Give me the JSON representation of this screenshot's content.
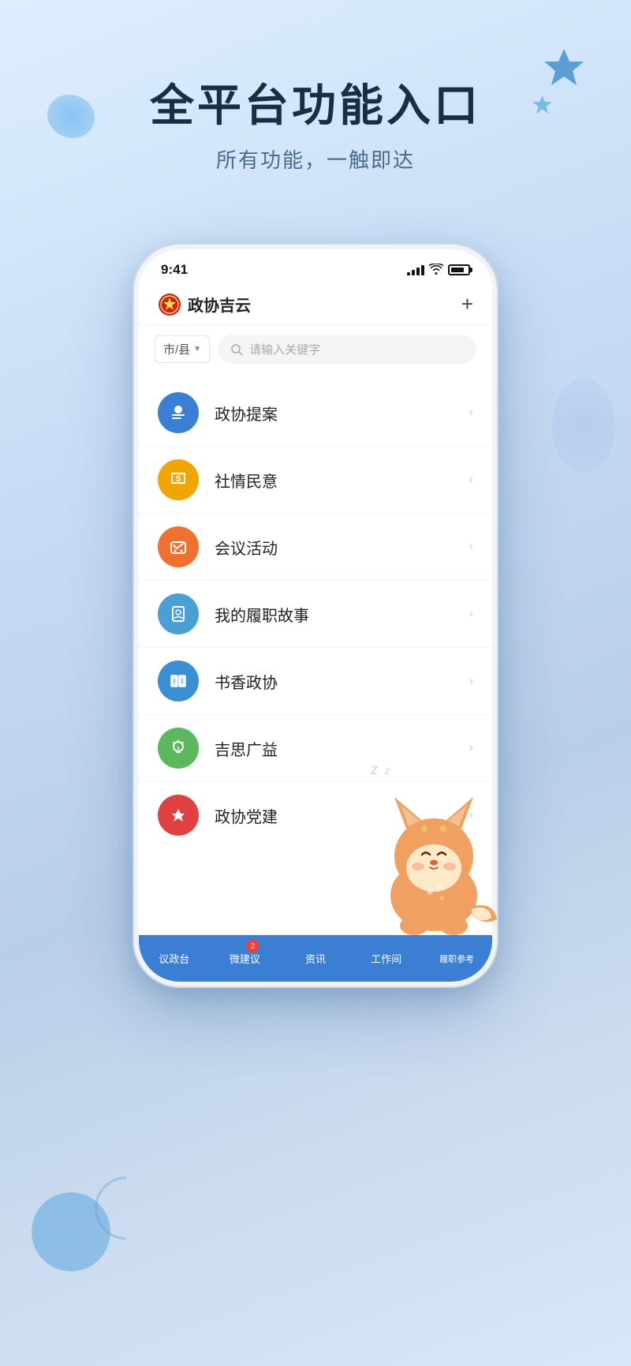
{
  "background": {
    "gradient_start": "#ddeeff",
    "gradient_end": "#d8e8f8"
  },
  "header": {
    "main_title": "全平台功能入口",
    "sub_title": "所有功能，一触即达"
  },
  "phone": {
    "status_bar": {
      "time": "9:41"
    },
    "app_header": {
      "app_name": "政协吉云",
      "add_btn_label": "+"
    },
    "search": {
      "city_label": "市/县",
      "placeholder": "请输入关键字"
    },
    "menu_items": [
      {
        "id": "proposal",
        "label": "政协提案",
        "color": "#3b7fd4",
        "icon": "proposal"
      },
      {
        "id": "social",
        "label": "社情民意",
        "color": "#f0a500",
        "icon": "social"
      },
      {
        "id": "meeting",
        "label": "会议活动",
        "color": "#f07030",
        "icon": "meeting"
      },
      {
        "id": "duty",
        "label": "我的履职故事",
        "color": "#4a9fd4",
        "icon": "duty"
      },
      {
        "id": "book",
        "label": "书香政协",
        "color": "#3a8fd4",
        "icon": "book"
      },
      {
        "id": "idea",
        "label": "吉思广益",
        "color": "#5cb85c",
        "icon": "idea"
      },
      {
        "id": "party",
        "label": "政协党建",
        "color": "#e04040",
        "icon": "party"
      }
    ],
    "tab_bar": [
      {
        "id": "yizheng",
        "label": "议政台",
        "active": true
      },
      {
        "id": "weijianyi",
        "label": "微建议",
        "active": true,
        "badge": "2"
      },
      {
        "id": "zixun",
        "label": "资讯",
        "active": true
      },
      {
        "id": "gongjian",
        "label": "工作间",
        "active": true
      },
      {
        "id": "lvzhi",
        "label": "履职参考",
        "active": true
      }
    ]
  }
}
